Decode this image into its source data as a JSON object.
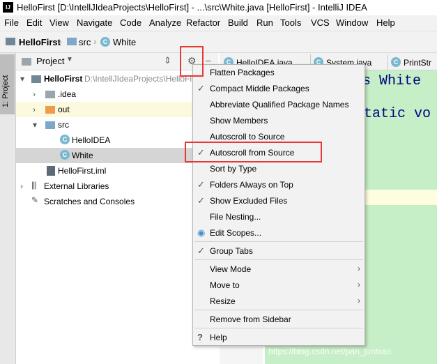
{
  "window": {
    "title": "HelloFirst [D:\\IntellJIdeaProjects\\HelloFirst] - ...\\src\\White.java [HelloFirst] - IntelliJ IDEA",
    "app_icon": "IJ"
  },
  "menubar": {
    "items": [
      "File",
      "Edit",
      "View",
      "Navigate",
      "Code",
      "Analyze",
      "Refactor",
      "Build",
      "Run",
      "Tools",
      "VCS",
      "Window",
      "Help"
    ]
  },
  "breadcrumb": {
    "items": [
      "HelloFirst",
      "src",
      "White"
    ]
  },
  "left_stripe": {
    "label": "1: Project"
  },
  "project_panel": {
    "title": "Project",
    "tree": [
      {
        "label": "HelloFirst",
        "path": "D:\\IntellJIdeaProjects\\HelloFi",
        "icon": "module-folder-icon"
      },
      {
        "label": ".idea",
        "icon": "folder-icon"
      },
      {
        "label": "out",
        "icon": "folder-icon"
      },
      {
        "label": "src",
        "icon": "source-folder-icon"
      },
      {
        "label": "HelloIDEA",
        "icon": "class-icon"
      },
      {
        "label": "White",
        "icon": "class-icon"
      },
      {
        "label": "HelloFirst.iml",
        "icon": "iml-file-icon"
      },
      {
        "label": "External Libraries",
        "icon": "library-icon"
      },
      {
        "label": "Scratches and Consoles",
        "icon": "scratches-icon"
      }
    ]
  },
  "editor": {
    "tabs": [
      "HelloIDEA.java",
      "System.java",
      "PrintStr"
    ],
    "code_lines": [
      "s White",
      "static vo"
    ]
  },
  "dropdown": {
    "items": [
      {
        "label": "Flatten Packages",
        "checked": false
      },
      {
        "label": "Compact Middle Packages",
        "checked": true
      },
      {
        "label": "Abbreviate Qualified Package Names",
        "checked": false
      },
      {
        "label": "Show Members",
        "checked": false
      },
      {
        "label": "Autoscroll to Source",
        "checked": false
      },
      {
        "label": "Autoscroll from Source",
        "checked": true
      },
      {
        "label": "Sort by Type",
        "checked": false
      },
      {
        "label": "Folders Always on Top",
        "checked": true
      },
      {
        "label": "Show Excluded Files",
        "checked": true
      },
      {
        "label": "File Nesting...",
        "checked": false
      },
      {
        "label": "Edit Scopes...",
        "checked": false
      },
      {
        "label": "Group Tabs",
        "checked": true
      },
      {
        "label": "View Mode",
        "checked": false
      },
      {
        "label": "Move to",
        "checked": false
      },
      {
        "label": "Resize",
        "checked": false
      },
      {
        "label": "Remove from Sidebar",
        "checked": false
      },
      {
        "label": "Help",
        "checked": false
      }
    ]
  },
  "colors": {
    "highlight_box": "#e53935",
    "selected_row": "#d5d5d5",
    "editor_green": "#c7efc7"
  },
  "watermark": "https://blog.csdn.net/pan_junbiao"
}
